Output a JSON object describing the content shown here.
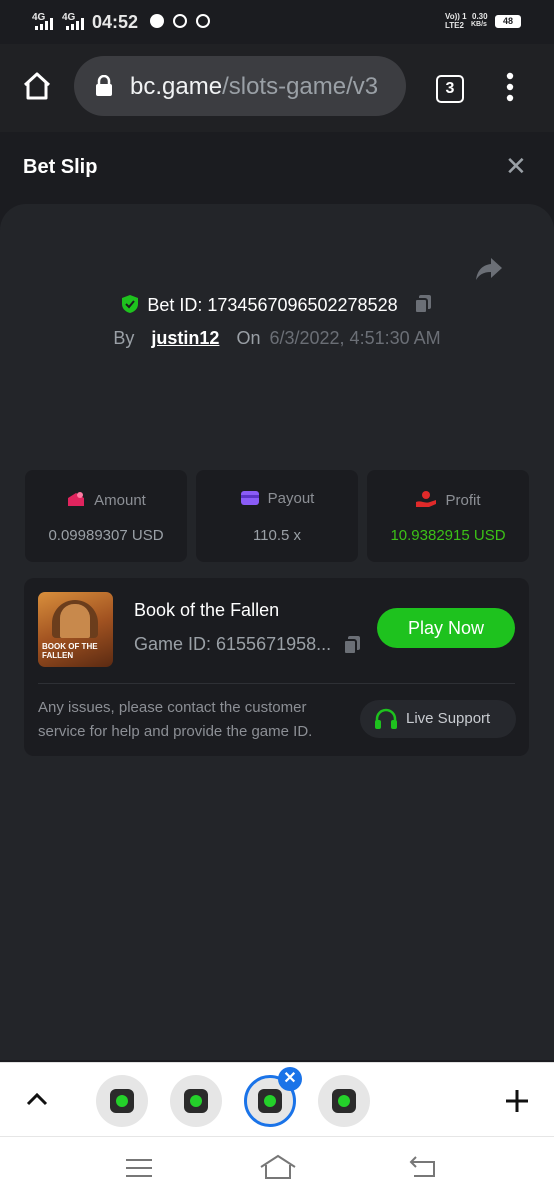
{
  "status_bar": {
    "network1": "4G",
    "network2": "4G",
    "time": "04:52",
    "volte": "Vo)) 1",
    "lte": "LTE2",
    "speed": "0.30",
    "speed_unit": "KB/s",
    "battery": "48"
  },
  "browser": {
    "url_host": "bc.game",
    "url_path": "/slots-game/v3",
    "tab_count": "3"
  },
  "bet_slip": {
    "title": "Bet Slip",
    "bet_id_label": "Bet ID: 1734567096502278528",
    "by_label": "By",
    "user": "justin12",
    "on_label": "On",
    "datetime": "6/3/2022, 4:51:30 AM"
  },
  "stats": [
    {
      "label": "Amount",
      "value": "0.09989307 USD",
      "icon": "amount-icon",
      "icon_color": "#e0245e",
      "value_color": "#9aa0a6"
    },
    {
      "label": "Payout",
      "value": "110.5 x",
      "icon": "wallet-icon",
      "icon_color": "#8a5cf6",
      "value_color": "#9aa0a6"
    },
    {
      "label": "Profit",
      "value": "10.9382915 USD",
      "icon": "profit-icon",
      "icon_color": "#e02a2a",
      "value_color": "#3bc117"
    }
  ],
  "game": {
    "name": "Book of the Fallen",
    "game_id": "Game ID: 6155671958...",
    "play_label": "Play Now",
    "thumb_text": "BOOK OF THE FALLEN",
    "notice": "Any issues, please contact the customer service for help and provide the game ID.",
    "support_label": "Live Support"
  },
  "colors": {
    "accent_green": "#1ec21e",
    "background": "#1b1c20",
    "card": "#232529"
  }
}
